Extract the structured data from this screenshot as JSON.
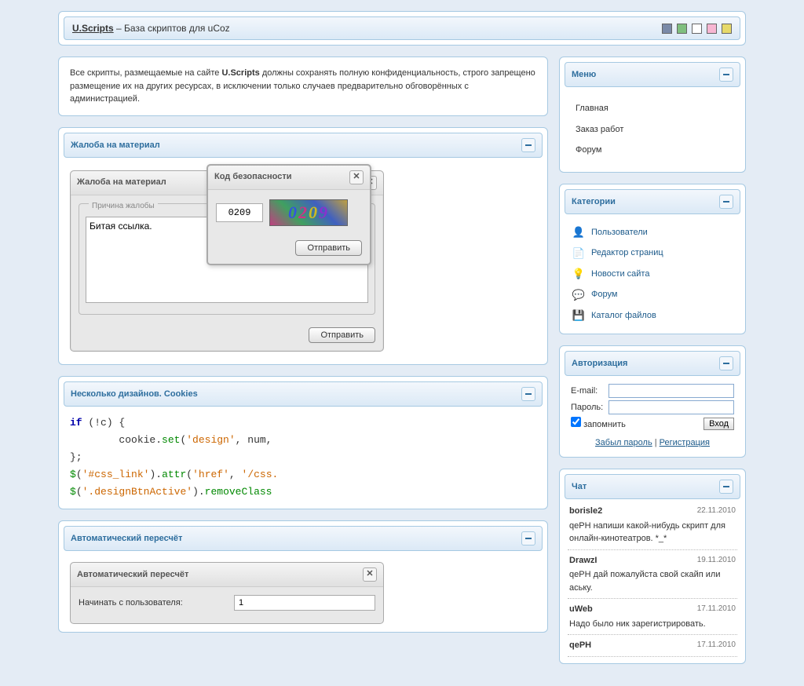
{
  "topbar": {
    "brand": "U.Scripts",
    "tagline": " – База скриптов для uCoz"
  },
  "swatches": [
    "#7a8aa8",
    "#7fbf7f",
    "#ffffff",
    "#f7b6d2",
    "#e6d96a"
  ],
  "notice": {
    "pre": "Все скрипты, размещаемые на сайте ",
    "bold": "U.Scripts",
    "post": " должны сохранять полную конфиденциальность, строго запрещено размещение их на других ресурсах, в исключении только случаев предварительно обговорённых с администрацией."
  },
  "panels": {
    "complaint_title": "Жалоба на материал",
    "cookies_title": "Несколько дизайнов. Cookies",
    "recount_title": "Автоматический пересчёт"
  },
  "complaint_dialog": {
    "title": "Жалоба на материал",
    "legend": "Причина жалобы",
    "text": "Битая ссылка.",
    "send": "Отправить"
  },
  "security_dialog": {
    "title": "Код безопасности",
    "value": "0209",
    "captcha": [
      "0",
      "2",
      "0",
      "9"
    ],
    "send": "Отправить"
  },
  "code_lines": [
    [
      {
        "c": "kw",
        "t": "if"
      },
      {
        "c": "",
        "t": " (!c) {"
      }
    ],
    [
      {
        "c": "",
        "t": "        cookie."
      },
      {
        "c": "fn",
        "t": "set"
      },
      {
        "c": "",
        "t": "("
      },
      {
        "c": "str",
        "t": "'design'"
      },
      {
        "c": "",
        "t": ", num,"
      }
    ],
    [
      {
        "c": "",
        "t": "};"
      }
    ],
    [
      {
        "c": "fn",
        "t": "$"
      },
      {
        "c": "",
        "t": "("
      },
      {
        "c": "str",
        "t": "'#css_link'"
      },
      {
        "c": "",
        "t": ")."
      },
      {
        "c": "fn",
        "t": "attr"
      },
      {
        "c": "",
        "t": "("
      },
      {
        "c": "str",
        "t": "'href'"
      },
      {
        "c": "",
        "t": ", "
      },
      {
        "c": "str",
        "t": "'/css."
      }
    ],
    [
      {
        "c": "fn",
        "t": "$"
      },
      {
        "c": "",
        "t": "("
      },
      {
        "c": "str",
        "t": "'.designBtnActive'"
      },
      {
        "c": "",
        "t": ")."
      },
      {
        "c": "fn",
        "t": "removeClass"
      }
    ]
  ],
  "recount_dialog": {
    "title": "Автоматический пересчёт",
    "row1_label": "Начинать с пользователя:",
    "row1_val": "1"
  },
  "menu": {
    "title": "Меню",
    "items": [
      "Главная",
      "Заказ работ",
      "Форум"
    ]
  },
  "categories": {
    "title": "Категории",
    "items": [
      {
        "icon": "👤",
        "label": "Пользователи"
      },
      {
        "icon": "📄",
        "label": "Редактор страниц"
      },
      {
        "icon": "💡",
        "label": "Новости сайта"
      },
      {
        "icon": "💬",
        "label": "Форум"
      },
      {
        "icon": "💾",
        "label": "Каталог файлов"
      }
    ]
  },
  "auth": {
    "title": "Авторизация",
    "email": "E-mail:",
    "password": "Пароль:",
    "remember": "запомнить",
    "login": "Вход",
    "forgot": "Забыл пароль",
    "register": "Регистрация",
    "sep": " | "
  },
  "chat": {
    "title": "Чат",
    "messages": [
      {
        "user": "borisle2",
        "date": "22.11.2010",
        "text": "qePH напиши какой-нибудь скрипт для онлайн-кинотеатров. *_*"
      },
      {
        "user": "DrawzI",
        "date": "19.11.2010",
        "text": "qePH дай пожалуйста свой скайп или аську."
      },
      {
        "user": "uWeb",
        "date": "17.11.2010",
        "text": "Надо было ник зарегистрировать."
      },
      {
        "user": "qePH",
        "date": "17.11.2010",
        "text": ""
      }
    ]
  }
}
